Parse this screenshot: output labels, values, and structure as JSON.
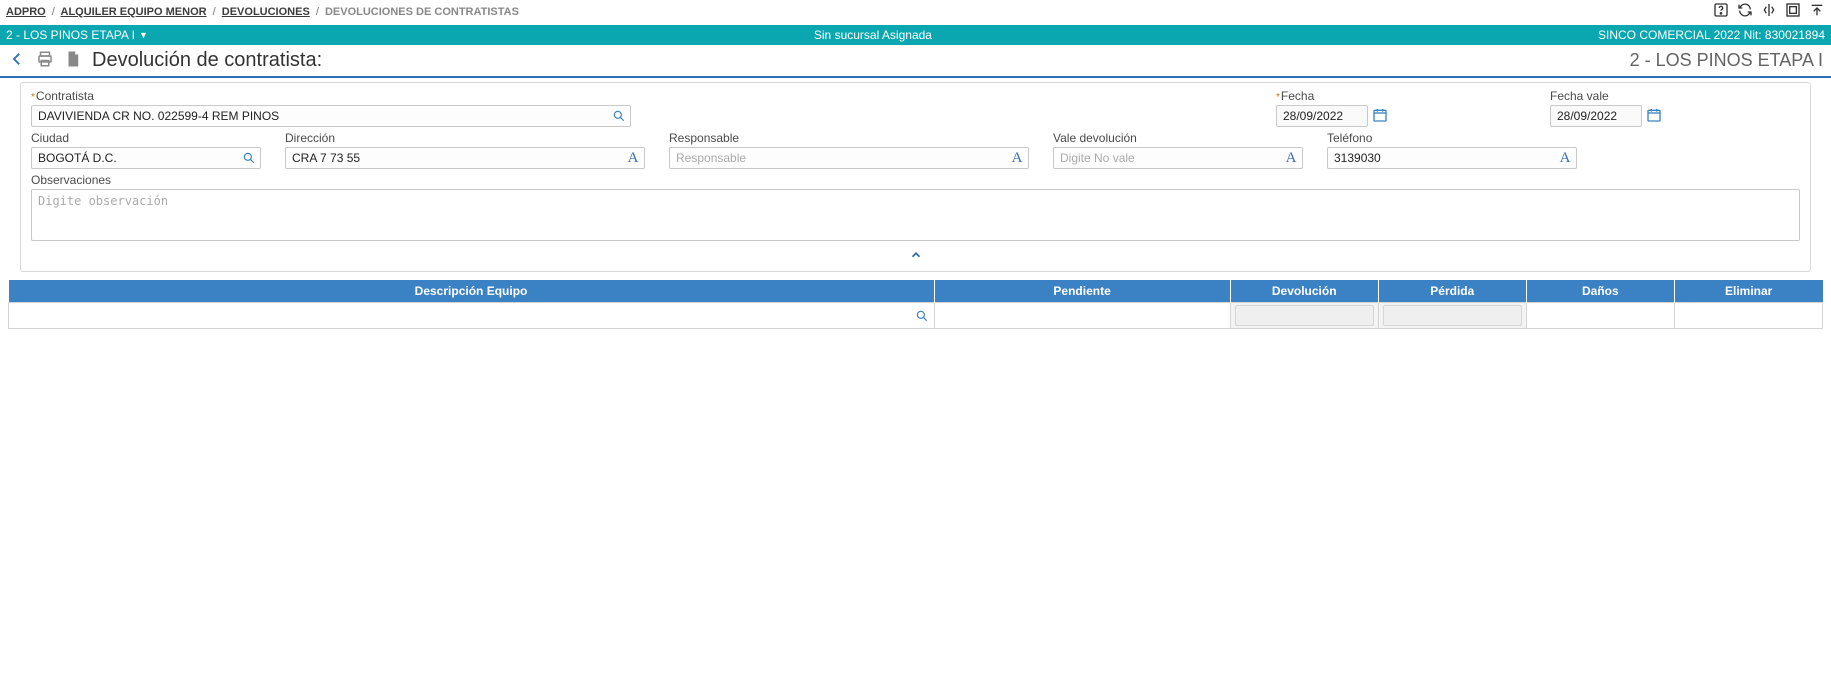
{
  "breadcrumb": {
    "items": [
      "ADPRO",
      "ALQUILER EQUIPO MENOR",
      "DEVOLUCIONES"
    ],
    "current": "DEVOLUCIONES DE CONTRATISTAS"
  },
  "context_bar": {
    "left": "2 - LOS PINOS ETAPA I",
    "center": "Sin sucursal Asignada",
    "right": "SINCO COMERCIAL 2022 Nit: 830021894"
  },
  "header": {
    "title": "Devolución de contratista:",
    "right": "2 - LOS PINOS ETAPA I"
  },
  "form": {
    "contratista": {
      "label": "Contratista",
      "value": "DAVIVIENDA CR NO. 022599-4 REM PINOS"
    },
    "fecha": {
      "label": "Fecha",
      "value": "28/09/2022"
    },
    "fecha_vale": {
      "label": "Fecha vale",
      "value": "28/09/2022"
    },
    "ciudad": {
      "label": "Ciudad",
      "value": "BOGOTÁ D.C."
    },
    "direccion": {
      "label": "Dirección",
      "value": "CRA 7 73 55"
    },
    "responsable": {
      "label": "Responsable",
      "value": "",
      "placeholder": "Responsable"
    },
    "vale_devolucion": {
      "label": "Vale devolución",
      "value": "",
      "placeholder": "Digite No vale"
    },
    "telefono": {
      "label": "Teléfono",
      "value": "3139030"
    },
    "observaciones": {
      "label": "Observaciones",
      "placeholder": "Digite observación",
      "value": ""
    }
  },
  "table": {
    "headers": {
      "descripcion": "Descripción Equipo",
      "pendiente": "Pendiente",
      "devolucion": "Devolución",
      "perdida": "Pérdida",
      "danos": "Daños",
      "eliminar": "Eliminar"
    },
    "row": {
      "descripcion": "",
      "pendiente": "",
      "devolucion": "",
      "perdida": "",
      "danos": "",
      "eliminar": ""
    }
  },
  "icons": {
    "help": "help-icon",
    "refresh": "refresh-icon",
    "split": "split-icon",
    "expand": "expand-icon",
    "collapse_up": "collapse-up-icon",
    "back": "back-icon",
    "print": "print-icon",
    "document": "document-icon",
    "search": "search-icon",
    "calendar": "calendar-icon",
    "chevron_up": "chevron-up-icon"
  }
}
